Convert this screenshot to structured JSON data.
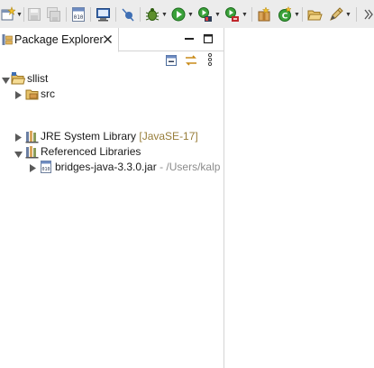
{
  "toolbar": {
    "icons": [
      "new-icon",
      "save-icon",
      "save-all-icon",
      "binary-icon",
      "console-icon",
      "breakpoint-icon",
      "debug-icon",
      "run-icon",
      "coverage-icon",
      "external-tools-icon",
      "new-package-icon",
      "new-class-icon",
      "open-folder-icon",
      "search-icon"
    ]
  },
  "package_explorer": {
    "tab_title": "Package Explorer",
    "tree": {
      "project": "sllist",
      "src": "src",
      "jre_label": "JRE System Library",
      "jre_decoration": "[JavaSE-17]",
      "referenced_libraries": "Referenced Libraries",
      "jar_name": "bridges-java-3.3.0.jar",
      "jar_path": " - /Users/kalp"
    }
  },
  "colors": {
    "decoration": "#977d39",
    "path_grey": "#8c8c8c",
    "toolbar_bg": "#ececec"
  }
}
